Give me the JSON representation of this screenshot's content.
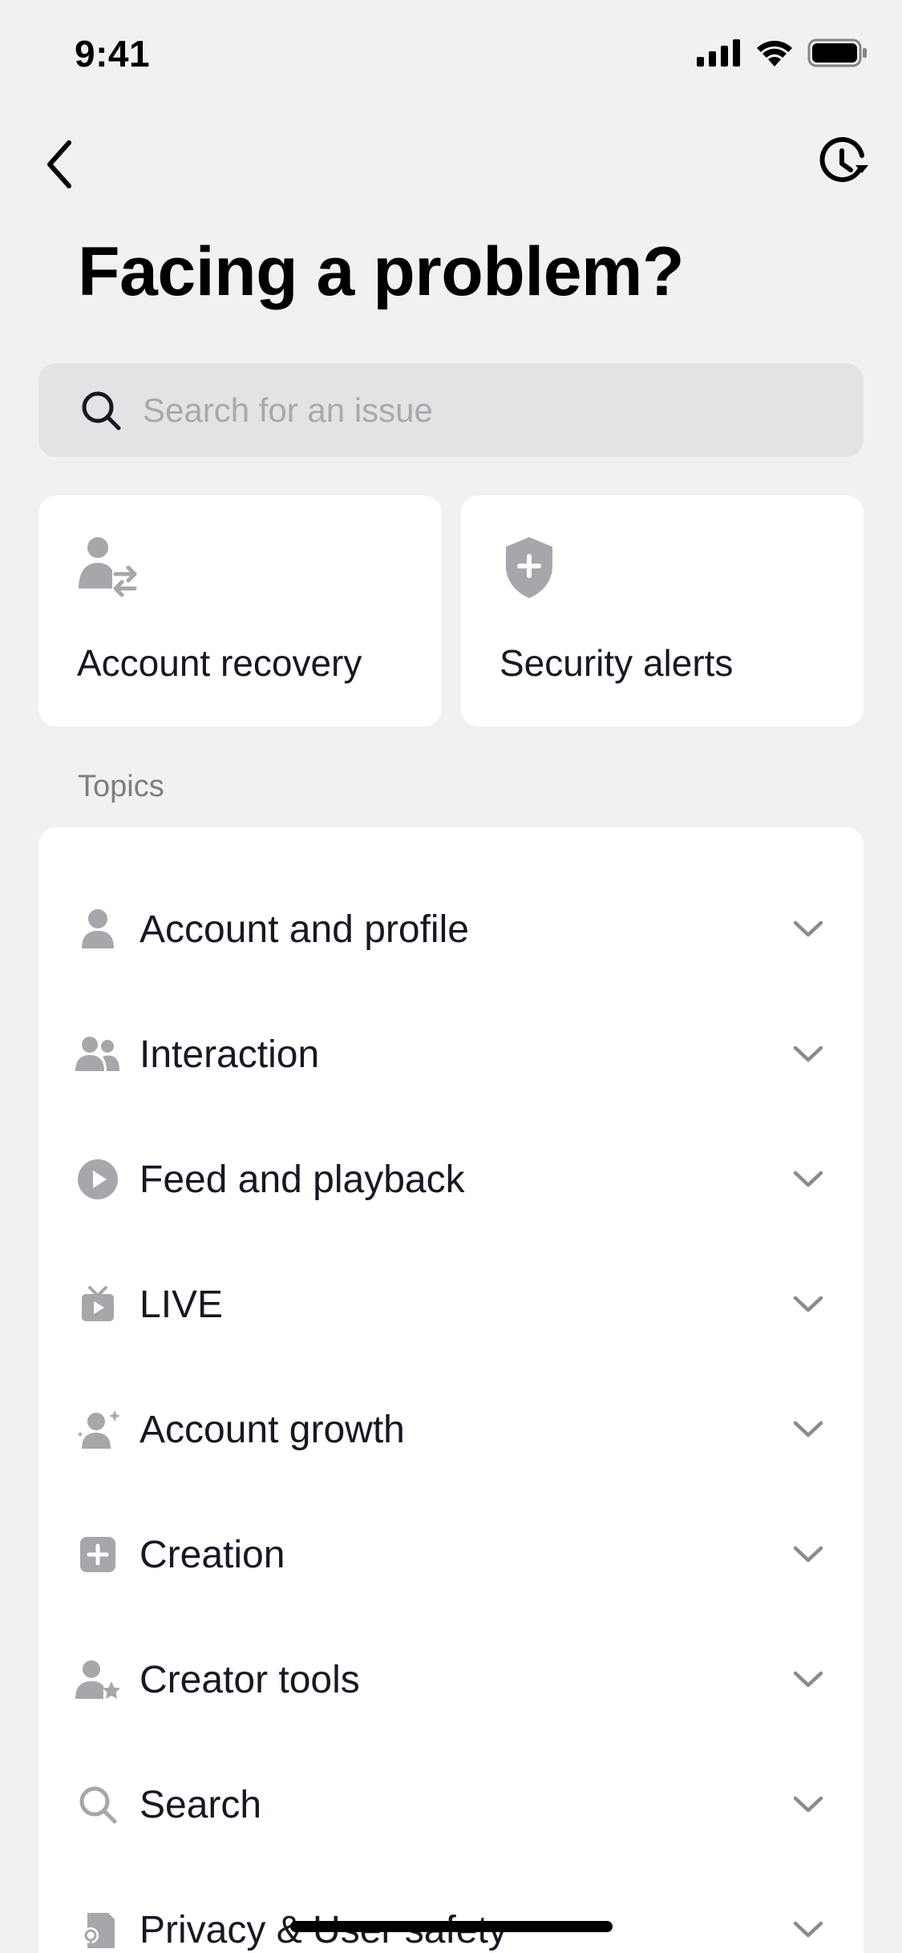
{
  "status_bar": {
    "time": "9:41"
  },
  "page": {
    "title": "Facing a problem?",
    "search": {
      "placeholder": "Search for an issue",
      "value": ""
    }
  },
  "quick_cards": [
    {
      "label": "Account recovery",
      "icon": "account-switch-icon"
    },
    {
      "label": "Security alerts",
      "icon": "shield-plus-icon"
    }
  ],
  "topics_section": {
    "label": "Topics",
    "items": [
      {
        "label": "Account and profile",
        "icon": "person-icon"
      },
      {
        "label": "Interaction",
        "icon": "people-icon"
      },
      {
        "label": "Feed and playback",
        "icon": "play-circle-icon"
      },
      {
        "label": "LIVE",
        "icon": "live-tv-icon"
      },
      {
        "label": "Account growth",
        "icon": "person-sparkle-icon"
      },
      {
        "label": "Creation",
        "icon": "plus-square-icon"
      },
      {
        "label": "Creator tools",
        "icon": "person-star-icon"
      },
      {
        "label": "Search",
        "icon": "search-icon"
      },
      {
        "label": "Privacy & User safety",
        "icon": "privacy-icon"
      }
    ]
  },
  "colors": {
    "background": "#f1f1f2",
    "card": "#ffffff",
    "search_bg": "#e3e3e6",
    "icon_gray": "#a7a7ab",
    "text_primary": "#161823",
    "text_secondary": "#7d7e84"
  }
}
